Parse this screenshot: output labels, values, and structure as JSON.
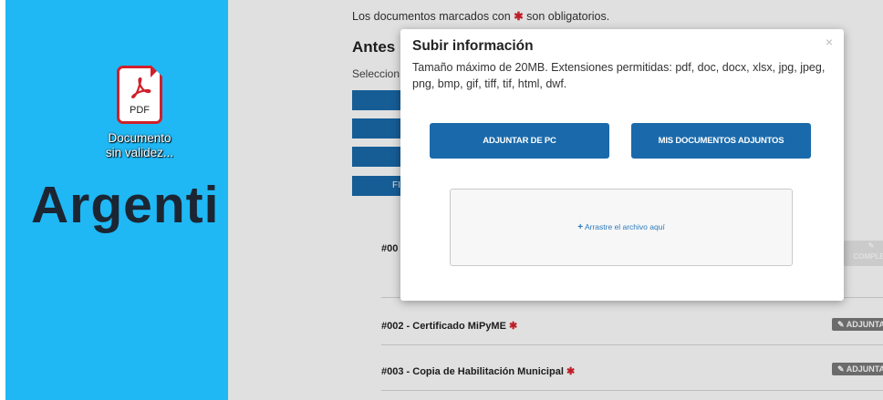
{
  "desktop": {
    "file_icon": "pdf-icon",
    "pdf_badge": "PDF",
    "file_label_line1": "Documento",
    "file_label_line2": "sin validez...",
    "brand_text": "Argenti",
    "background_color": "#1fb8f5"
  },
  "page": {
    "required_note_before": "Los documentos marcados con",
    "required_star": "✱",
    "required_note_after": "son obligatorios.",
    "section_title": "Antes",
    "section_sub": "Seleccion",
    "button_partial_text": "FI",
    "documents": [
      {
        "code": "#00",
        "label": "",
        "required": false
      },
      {
        "code": "#002",
        "label": "#002 - Certificado MiPyME",
        "required": true
      },
      {
        "code": "#003",
        "label": "#003 - Copia de Habilitación Municipal",
        "required": true
      }
    ],
    "row1_tag": "COMPLET",
    "attach_tag": "ADJUNTA",
    "accent_color": "#1a6aab",
    "required_color": "#d9232d"
  },
  "modal": {
    "title": "Subir información",
    "description": "Tamaño máximo de 20MB. Extensiones permitidas: pdf, doc, docx, xlsx, jpg, jpeg, png, bmp, gif, tiff, tif, html, dwf.",
    "close_label": "×",
    "attach_pc_label": "ADJUNTAR DE PC",
    "my_docs_label": "MIS DOCUMENTOS ADJUNTOS",
    "drop_label": "Arrastre el archivo aquí",
    "drop_icon": "plus-icon"
  }
}
